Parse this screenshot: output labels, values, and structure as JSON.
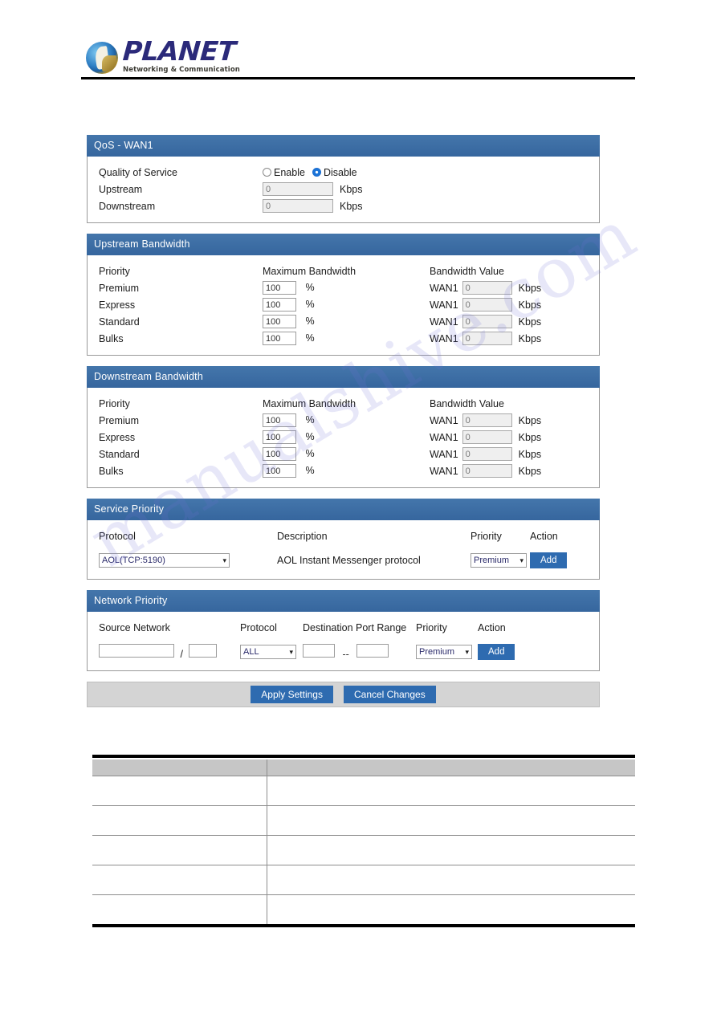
{
  "brand": {
    "name": "PLANET",
    "tagline": "Networking & Communication",
    "logo_icon": "planet-globe-logo"
  },
  "colors": {
    "panel_header_blue": "#3b6ea5",
    "button_blue": "#2e6bb0",
    "apply_bar_grey": "#d4d4d4",
    "table_header_grey": "#c6c6c6",
    "radio_selected_blue": "#1b74d8"
  },
  "qos_panel": {
    "title": "QoS - WAN1",
    "quality_of_service": {
      "label": "Quality of Service",
      "options": [
        "Enable",
        "Disable"
      ],
      "selected": "Disable"
    },
    "upstream": {
      "label": "Upstream",
      "value": "0",
      "unit": "Kbps"
    },
    "downstream": {
      "label": "Downstream",
      "value": "0",
      "unit": "Kbps"
    }
  },
  "upstream_bandwidth": {
    "title": "Upstream Bandwidth",
    "headers": [
      "Priority",
      "Maximum Bandwidth",
      "Bandwidth Value"
    ],
    "percent_unit": "%",
    "kbps_unit": "Kbps",
    "wan_label": "WAN1",
    "rows": [
      {
        "priority": "Premium",
        "max_bandwidth": "100",
        "bandwidth_value": "0"
      },
      {
        "priority": "Express",
        "max_bandwidth": "100",
        "bandwidth_value": "0"
      },
      {
        "priority": "Standard",
        "max_bandwidth": "100",
        "bandwidth_value": "0"
      },
      {
        "priority": "Bulks",
        "max_bandwidth": "100",
        "bandwidth_value": "0"
      }
    ]
  },
  "downstream_bandwidth": {
    "title": "Downstream Bandwidth",
    "headers": [
      "Priority",
      "Maximum Bandwidth",
      "Bandwidth Value"
    ],
    "percent_unit": "%",
    "kbps_unit": "Kbps",
    "wan_label": "WAN1",
    "rows": [
      {
        "priority": "Premium",
        "max_bandwidth": "100",
        "bandwidth_value": "0"
      },
      {
        "priority": "Express",
        "max_bandwidth": "100",
        "bandwidth_value": "0"
      },
      {
        "priority": "Standard",
        "max_bandwidth": "100",
        "bandwidth_value": "0"
      },
      {
        "priority": "Bulks",
        "max_bandwidth": "100",
        "bandwidth_value": "0"
      }
    ]
  },
  "service_priority": {
    "title": "Service Priority",
    "headers": {
      "protocol": "Protocol",
      "description": "Description",
      "priority": "Priority",
      "action": "Action"
    },
    "row": {
      "protocol_selected": "AOL(TCP:5190)",
      "description": "AOL Instant Messenger protocol",
      "priority_selected": "Premium",
      "add_label": "Add"
    }
  },
  "network_priority": {
    "title": "Network Priority",
    "headers": {
      "source_network": "Source Network",
      "protocol": "Protocol",
      "destination_port_range": "Destination Port Range",
      "priority": "Priority",
      "action": "Action"
    },
    "row": {
      "source_network_value": "",
      "source_mask_value": "",
      "slash": "/",
      "protocol_selected": "ALL",
      "port_from": "",
      "port_to": "",
      "port_separator": "--",
      "priority_selected": "Premium",
      "add_label": "Add"
    }
  },
  "actions": {
    "apply_label": "Apply Settings",
    "cancel_label": "Cancel Changes"
  },
  "doc_table": {
    "headers": [
      "",
      ""
    ],
    "rows": [
      {
        "left": "",
        "right": ""
      },
      {
        "left": "",
        "right": ""
      },
      {
        "left": "",
        "right": ""
      },
      {
        "left": "",
        "right": ""
      },
      {
        "left": "",
        "right": ""
      }
    ]
  },
  "watermark": {
    "text": "manualshive.com"
  }
}
